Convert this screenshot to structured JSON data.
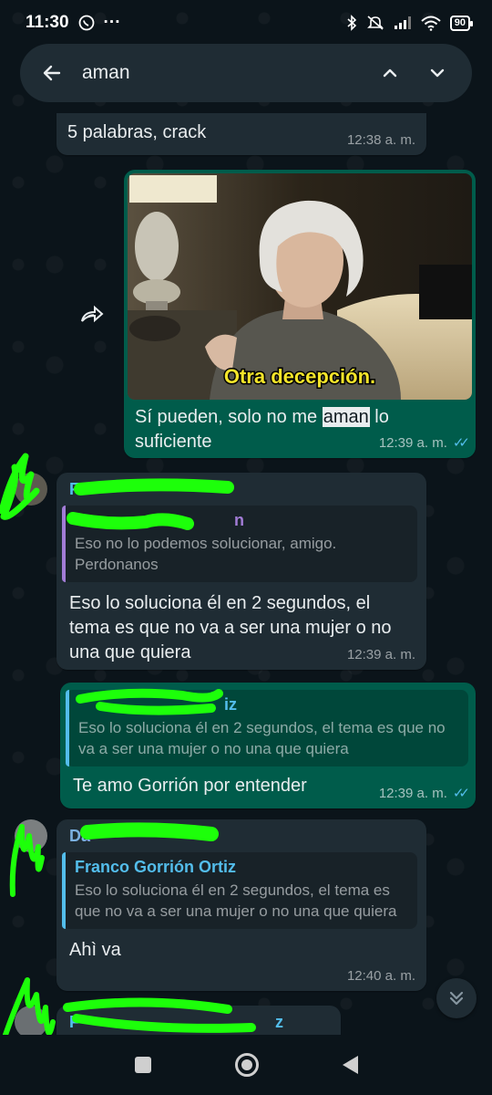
{
  "status_bar": {
    "time": "11:30",
    "extra": "···",
    "battery": "90"
  },
  "search": {
    "query": "aman"
  },
  "messages": [
    {
      "type": "incoming",
      "text": "5 palabras, crack",
      "time": "12:38 a. m."
    },
    {
      "type": "outgoing",
      "image": "gif-thumbnail",
      "caption_on_image": "Otra decepción.",
      "text_before": "Sí pueden, solo no me ",
      "highlight": "aman",
      "text_after": " lo suficiente",
      "time": "12:39 a. m."
    },
    {
      "type": "incoming",
      "sender": "F",
      "quote": {
        "name": "n",
        "text": "Eso no lo podemos solucionar, amigo. Perdonanos"
      },
      "text": "Eso lo soluciona él en 2 segundos, el tema es que no va a ser una mujer o no una que quiera",
      "time": "12:39 a. m."
    },
    {
      "type": "outgoing",
      "quote": {
        "name": "iz",
        "text": "Eso lo soluciona él en 2 segundos, el tema es que no va a ser una mujer o no una que quiera"
      },
      "text": "Te amo Gorrión por entender",
      "time": "12:39 a. m."
    },
    {
      "type": "incoming",
      "sender": "Da",
      "quote": {
        "name": "Franco Gorrión Ortiz",
        "text": "Eso lo soluciona él en 2 segundos, el tema es que no va a ser una mujer o no una que quiera"
      },
      "text": "Ahì va",
      "time": "12:40 a. m."
    },
    {
      "type": "incoming",
      "sender": "F",
      "sender_suffix": "z"
    }
  ],
  "colors": {
    "background": "#0b141a",
    "incoming": "#1f2c34",
    "outgoing": "#005c4b",
    "accent_blue": "#53bdeb",
    "scribble": "#1dff0a"
  }
}
